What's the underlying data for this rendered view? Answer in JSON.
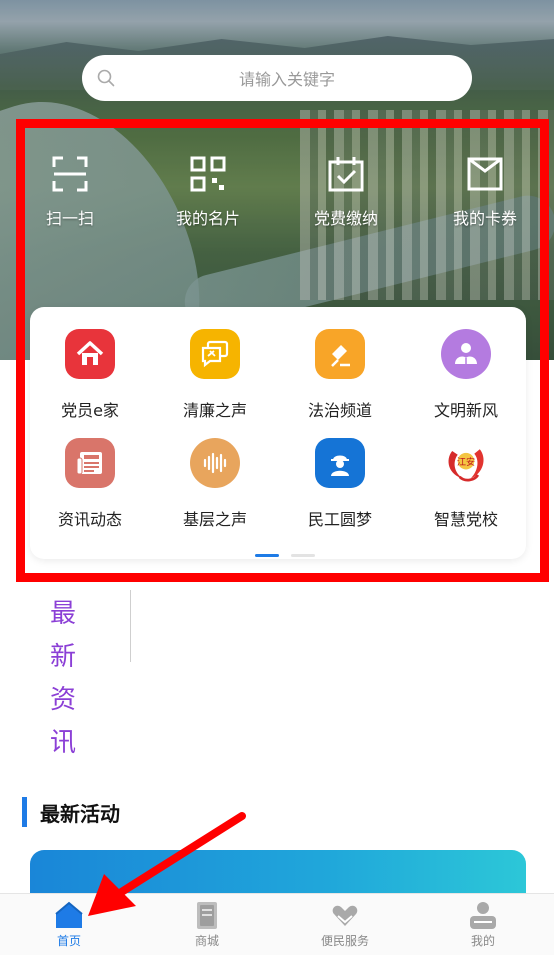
{
  "search": {
    "placeholder": "请输入关键字"
  },
  "quick_actions": [
    {
      "label": "扫一扫",
      "icon": "scan-icon"
    },
    {
      "label": "我的名片",
      "icon": "qr-card-icon"
    },
    {
      "label": "党费缴纳",
      "icon": "calendar-check-icon"
    },
    {
      "label": "我的卡券",
      "icon": "coupon-icon"
    }
  ],
  "services": [
    {
      "label": "党员e家",
      "icon": "home-icon",
      "color": "#e8343b"
    },
    {
      "label": "清廉之声",
      "icon": "chat-flag-icon",
      "color": "#f6b400"
    },
    {
      "label": "法治频道",
      "icon": "gavel-icon",
      "color": "#f8a528"
    },
    {
      "label": "文明新风",
      "icon": "reading-person-icon",
      "color": "#b47be0"
    },
    {
      "label": "资讯动态",
      "icon": "news-icon",
      "color": "#d9756a"
    },
    {
      "label": "基层之声",
      "icon": "soundwave-icon",
      "color": "#e8a55d"
    },
    {
      "label": "民工圆梦",
      "icon": "worker-icon",
      "color": "#1574d6"
    },
    {
      "label": "智慧党校",
      "icon": "party-school-logo-icon",
      "color": "#ffffff"
    }
  ],
  "logo_text": "江安",
  "news_section": {
    "chars": [
      "最",
      "新",
      "资",
      "讯"
    ]
  },
  "activity_section": {
    "title": "最新活动"
  },
  "tabbar": [
    {
      "label": "首页",
      "icon": "home-tab-icon",
      "active": true
    },
    {
      "label": "商城",
      "icon": "shop-book-icon",
      "active": false
    },
    {
      "label": "便民服务",
      "icon": "heart-hand-icon",
      "active": false
    },
    {
      "label": "我的",
      "icon": "profile-icon",
      "active": false
    }
  ],
  "colors": {
    "accent": "#1e7be6",
    "highlight": "#ff0000",
    "news": "#8b3fd6"
  }
}
